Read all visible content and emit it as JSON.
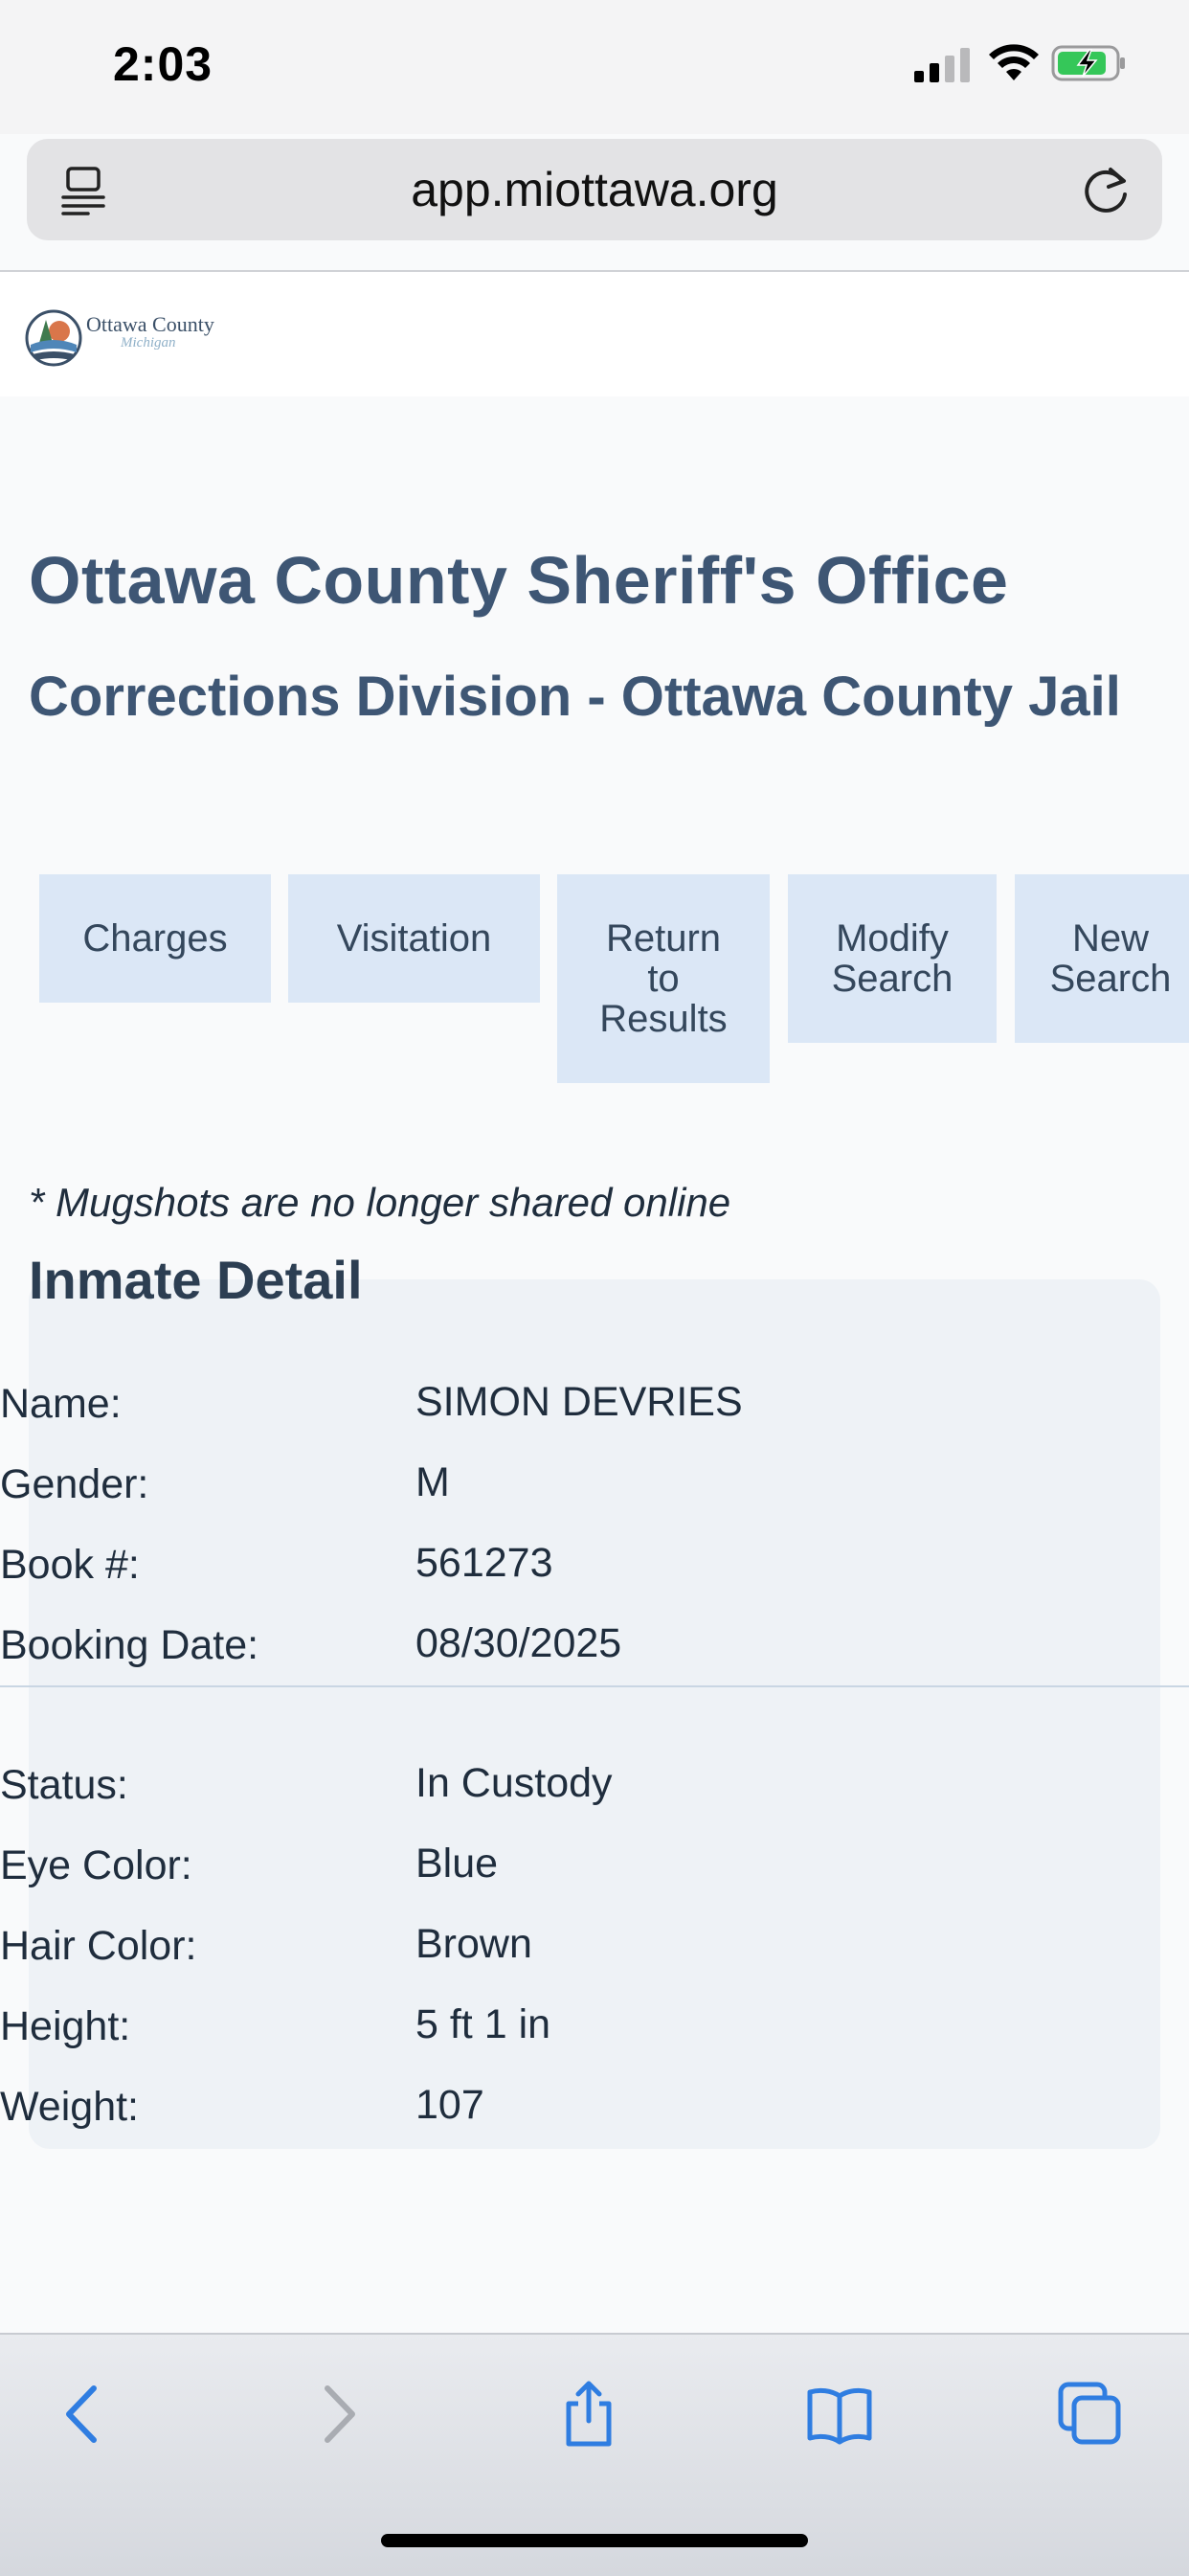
{
  "status_bar": {
    "time": "2:03"
  },
  "browser": {
    "url": "app.miottawa.org"
  },
  "logo": {
    "name": "Ottawa County",
    "sub": "Michigan"
  },
  "header": {
    "title": "Ottawa County Sheriff's Office",
    "subtitle": "Corrections Division - Ottawa County Jail"
  },
  "nav_buttons": {
    "charges": "Charges",
    "visitation": "Visitation",
    "return_l1": "Return",
    "return_l2": "to",
    "return_l3": "Results",
    "modify_l1": "Modify",
    "modify_l2": "Search",
    "new_l1": "New",
    "new_l2": "Search"
  },
  "note": "* Mugshots are no longer shared online",
  "detail": {
    "title": "Inmate Detail",
    "rows": [
      {
        "label": "Name:",
        "value": "SIMON DEVRIES"
      },
      {
        "label": "Gender:",
        "value": "M"
      },
      {
        "label": "Book #:",
        "value": "561273"
      },
      {
        "label": "Booking Date:",
        "value": "08/30/2025"
      },
      {
        "label": "Status:",
        "value": "In Custody"
      },
      {
        "label": "Eye Color:",
        "value": "Blue"
      },
      {
        "label": "Hair Color:",
        "value": "Brown"
      },
      {
        "label": "Height:",
        "value": "5 ft 1 in"
      },
      {
        "label": "Weight:",
        "value": "107"
      }
    ]
  },
  "colors": {
    "heading": "#3e5674",
    "button_bg": "#dbe7f6",
    "card_bg": "#eef2f6",
    "ios_blue": "#2f7de1"
  },
  "icons": {
    "toolbar": [
      "back-icon",
      "forward-icon",
      "share-icon",
      "bookmarks-icon",
      "tabs-icon"
    ]
  }
}
